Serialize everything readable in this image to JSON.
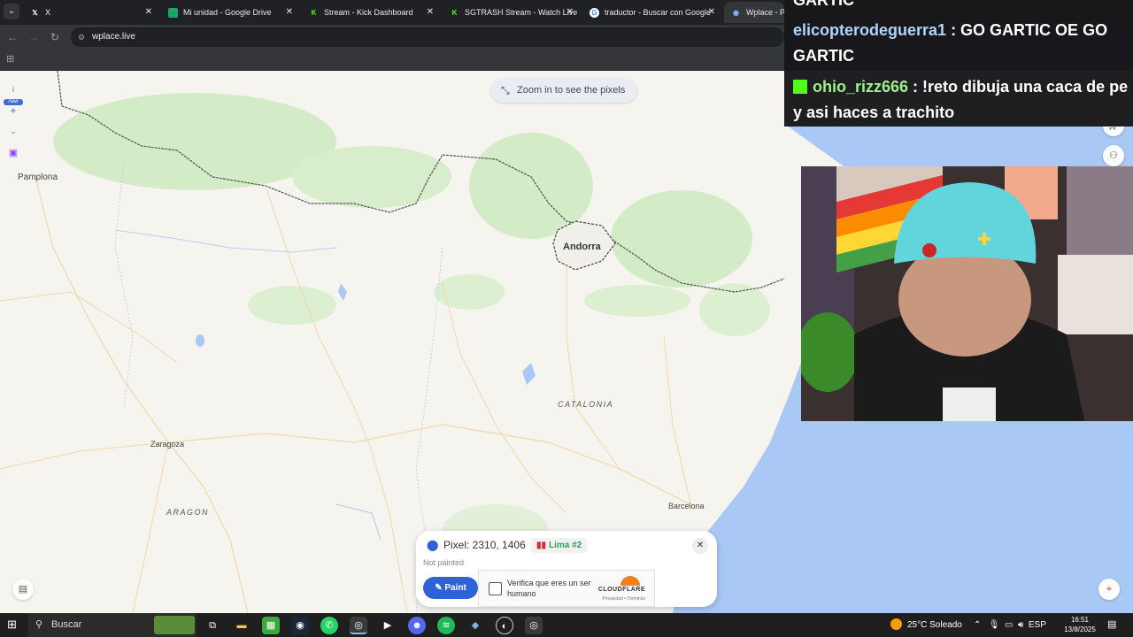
{
  "browser": {
    "tabs": [
      {
        "label": "X",
        "favicon": "x-logo-icon"
      },
      {
        "label": "Mi unidad - Google Drive",
        "favicon": "google-drive-icon"
      },
      {
        "label": "Stream - Kick Dashboard",
        "favicon": "kick-icon"
      },
      {
        "label": "SGTRASH Stream - Watch Live",
        "favicon": "kick-icon"
      },
      {
        "label": "traductor - Buscar con Google",
        "favicon": "google-icon"
      },
      {
        "label": "Wplace - Paint the world",
        "favicon": "wplace-icon",
        "active": true
      }
    ],
    "address": "wplace.live"
  },
  "map": {
    "zoom_hint": "Zoom in to see the pixels",
    "labels": {
      "pamplona": "Pamplona",
      "andorra": "Andorra",
      "catalonia": "CATALONIA",
      "zaragoza": "Zaragoza",
      "aragon": "ARAGON",
      "barcelona": "Barcelona"
    },
    "left_controls": {
      "info": "i",
      "new_badge": "new",
      "zoom_in": "+",
      "zoom_out": "-"
    }
  },
  "pixel_panel": {
    "coords": "Pixel: 2310, 1406",
    "territory": "Lima #2",
    "status": "Not painted",
    "paint_label": "Paint",
    "captcha_text": "Verifica que eres un ser humano",
    "captcha_brand": "CLOUDFLARE",
    "captcha_links": "Privacidad • Términos"
  },
  "chat": {
    "line0": "GARTIC",
    "msg1_user": "elicopterodeguerra1",
    "msg1_text": " : GO GARTIC OE GO GARTIC",
    "msg2_user": "ohio_rizz666",
    "msg2_text": " : !reto dibuja una caca de pe y asi haces a trachito"
  },
  "taskbar": {
    "search": "Buscar",
    "weather": "25°C  Soleado",
    "lang": "ESP",
    "time": "16:51",
    "date": "13/8/2025"
  },
  "colors": {
    "accent": "#2d63d6",
    "land": "#f6f4ef",
    "forest": "#d4ebc8",
    "sea": "#a9c8f5",
    "chat_bg": "#18181b"
  }
}
